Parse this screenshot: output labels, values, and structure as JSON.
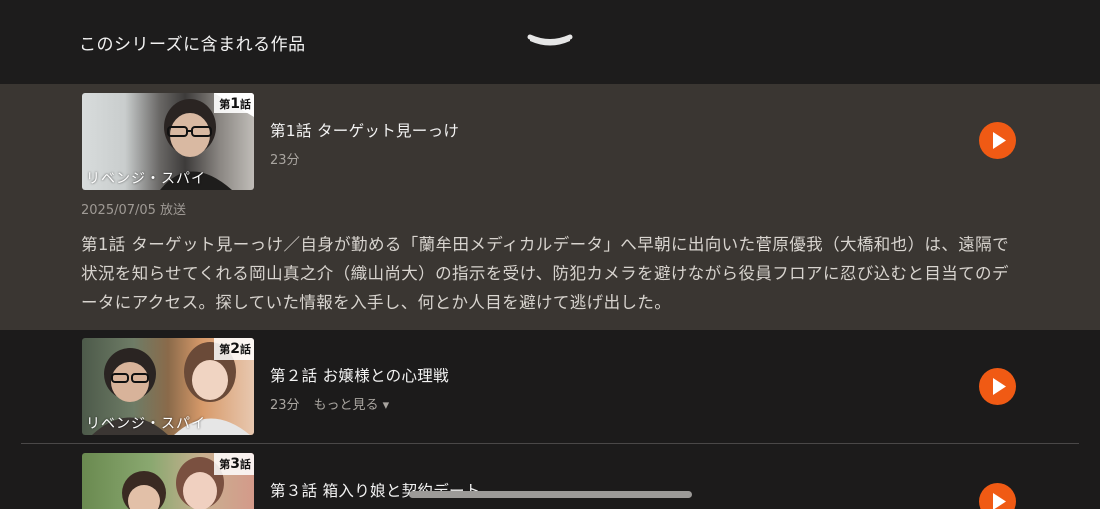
{
  "header": {
    "title": "このシリーズに含まれる作品",
    "collapse_icon": "chevron-down-icon"
  },
  "episodes": [
    {
      "badge_prefix": "第",
      "badge_num": "1",
      "badge_suffix": "話",
      "logo": "リベンジ・スパイ",
      "title": "第1話 ターゲット見ーっけ",
      "duration": "23分",
      "air_date": "2025/07/05 放送",
      "synopsis": "第1話 ターゲット見ーっけ／自身が勤める「蘭牟田メディカルデータ」へ早朝に出向いた菅原優我（大橋和也）は、遠隔で状況を知らせてくれる岡山真之介（織山尚大）の指示を受け、防犯カメラを避けながら役員フロアに忍び込むと目当てのデータにアクセス。探していた情報を入手し、何とか人目を避けて逃げ出した。"
    },
    {
      "badge_prefix": "第",
      "badge_num": "2",
      "badge_suffix": "話",
      "logo": "リベンジ・スパイ",
      "title": "第２話 お嬢様との心理戦",
      "duration": "23分",
      "more": "もっと見る ▾"
    },
    {
      "badge_prefix": "第",
      "badge_num": "3",
      "badge_suffix": "話",
      "title": "第３話 箱入り娘と契約デート"
    }
  ],
  "colors": {
    "accent": "#f05a14",
    "expanded_bg": "#3a3632",
    "page_bg": "#1c1b1b"
  }
}
